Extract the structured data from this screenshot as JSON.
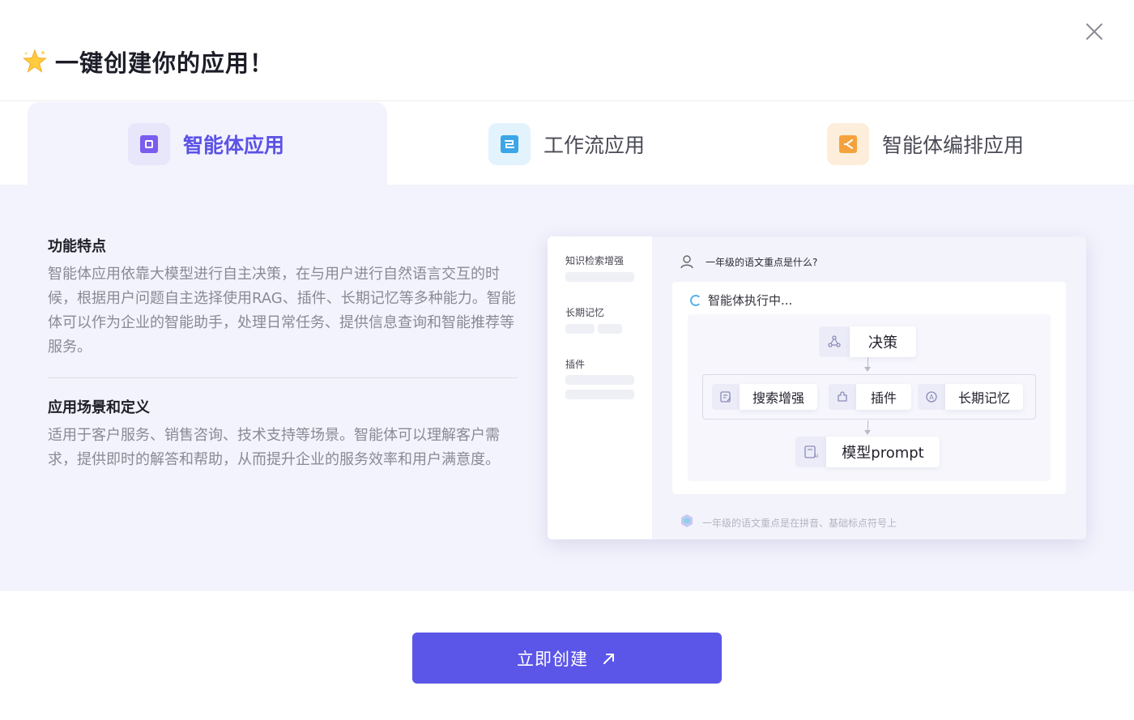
{
  "dialog": {
    "title": "一键创建你的应用！",
    "close_icon": "close-icon"
  },
  "tabs": [
    {
      "label": "智能体应用",
      "icon": "agent-app-icon",
      "active": true,
      "icon_color": "#5b52e6"
    },
    {
      "label": "工作流应用",
      "icon": "workflow-app-icon",
      "active": false,
      "icon_color": "#3aa6e8"
    },
    {
      "label": "智能体编排应用",
      "icon": "orchestration-app-icon",
      "active": false,
      "icon_color": "#f5a23c"
    }
  ],
  "features": {
    "title": "功能特点",
    "body": "智能体应用依靠大模型进行自主决策，在与用户进行自然语言交互的时候，根据用户问题自主选择使用RAG、插件、长期记忆等多种能力。智能体可以作为企业的智能助手，处理日常任务、提供信息查询和智能推荐等服务。"
  },
  "scenarios": {
    "title": "应用场景和定义",
    "body": "适用于客户服务、销售咨询、技术支持等场景。智能体可以理解客户需求，提供即时的解答和帮助，从而提升企业的服务效率和用户满意度。"
  },
  "preview": {
    "sidebar": [
      "知识检索增强",
      "长期记忆",
      "插件"
    ],
    "question": "一年级的语文重点是什么?",
    "executing": "智能体执行中...",
    "decision": "决策",
    "tools": [
      "搜索增强",
      "插件",
      "长期记忆"
    ],
    "model": "模型prompt",
    "answer": "一年级的语文重点是在拼音、基础标点符号上"
  },
  "cta": {
    "label": "立即创建",
    "icon": "arrow-up-right-icon"
  },
  "colors": {
    "accent": "#5b56e8",
    "band_bg": "#f3f3fd"
  }
}
